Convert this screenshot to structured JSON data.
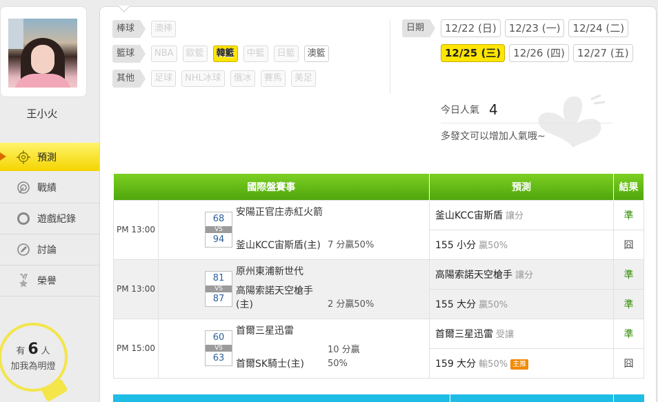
{
  "user": {
    "name": "王小火"
  },
  "nav": [
    {
      "label": "預測",
      "icon": "target-icon",
      "active": true
    },
    {
      "label": "戰績",
      "icon": "record-icon",
      "active": false
    },
    {
      "label": "遊戲紀錄",
      "icon": "ring-icon",
      "active": false
    },
    {
      "label": "討論",
      "icon": "chat-edit-icon",
      "active": false
    },
    {
      "label": "榮譽",
      "icon": "medal-icon",
      "active": false
    }
  ],
  "fans": {
    "prefix": "有",
    "count": "6",
    "suffix": "人",
    "line2": "加我為明燈"
  },
  "filters": [
    {
      "category": "棒球",
      "leagues": [
        {
          "label": "澳棒",
          "state": "off"
        }
      ]
    },
    {
      "category": "籃球",
      "leagues": [
        {
          "label": "NBA",
          "state": "off"
        },
        {
          "label": "歐籃",
          "state": "off"
        },
        {
          "label": "韓籃",
          "state": "sel"
        },
        {
          "label": "中籃",
          "state": "off"
        },
        {
          "label": "日籃",
          "state": "off"
        },
        {
          "label": "澳籃",
          "state": "on"
        }
      ]
    },
    {
      "category": "其他",
      "leagues": [
        {
          "label": "足球",
          "state": "off"
        },
        {
          "label": "NHL冰球",
          "state": "off"
        },
        {
          "label": "俄冰",
          "state": "off"
        },
        {
          "label": "賽馬",
          "state": "off"
        },
        {
          "label": "美足",
          "state": "off"
        }
      ]
    }
  ],
  "dates": {
    "label": "日期",
    "row1": [
      {
        "label": "12/22 (日)",
        "sel": false
      },
      {
        "label": "12/23 (一)",
        "sel": false
      },
      {
        "label": "12/24 (二)",
        "sel": false
      }
    ],
    "row2": [
      {
        "label": "12/25 (三)",
        "sel": true
      },
      {
        "label": "12/26 (四)",
        "sel": false
      },
      {
        "label": "12/27 (五)",
        "sel": false
      }
    ]
  },
  "popularity": {
    "label": "今日人氣",
    "value": "4",
    "hint": "多發文可以增加人氣哦~"
  },
  "table": {
    "headers": {
      "match": "國際盤賽事",
      "prediction": "預測",
      "result": "結果"
    },
    "games": [
      {
        "time": "PM 13:00",
        "score1": "68",
        "vs": "VS",
        "score2": "94",
        "team1": "安陽正官庄赤紅火箭",
        "team2": "釜山KCC宙斯盾(主)",
        "bet": "7 分贏50%",
        "bet2": "",
        "preds": [
          {
            "text": "釜山KCC宙斯盾",
            "note": "讓分",
            "tag": "",
            "result": "準"
          },
          {
            "text": "155 小分",
            "note": "贏50%",
            "tag": "",
            "result": "囧"
          }
        ]
      },
      {
        "time": "PM 13:00",
        "score1": "81",
        "vs": "VS",
        "score2": "87",
        "team1": "原州東浦新世代",
        "team2": "高陽索諾天空槍手(主)",
        "bet": "2 分贏50%",
        "bet2": "",
        "preds": [
          {
            "text": "高陽索諾天空槍手",
            "note": "讓分",
            "tag": "",
            "result": "準"
          },
          {
            "text": "155 大分",
            "note": "贏50%",
            "tag": "",
            "result": "準"
          }
        ]
      },
      {
        "time": "PM 15:00",
        "score1": "60",
        "vs": "VS",
        "score2": "63",
        "team1": "首爾三星迅雷",
        "team2": "首爾SK騎士(主)",
        "bet": "10 分贏",
        "bet2": "50%",
        "preds": [
          {
            "text": "首爾三星迅雷",
            "note": "受讓",
            "tag": "",
            "result": "準"
          },
          {
            "text": "159 大分",
            "note": "輸50%",
            "tag": "主推",
            "result": "囧"
          }
        ]
      }
    ]
  },
  "colors": {
    "accent_yellow": "#ffe600",
    "header_green": "#5cb814",
    "ok_green": "#2e8b00",
    "bottom_blue": "#1ebde6"
  }
}
